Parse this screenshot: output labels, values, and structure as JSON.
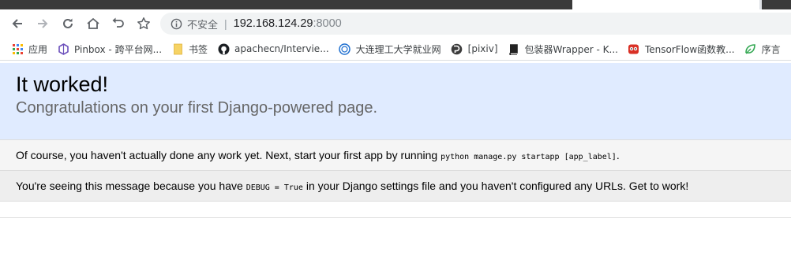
{
  "browser": {
    "address": {
      "security_label": "不安全",
      "separator": "|",
      "host": "192.168.124.29",
      "port": ":8000"
    },
    "bookmarks": [
      {
        "label": "应用",
        "icon": "apps-grid-icon"
      },
      {
        "label": "Pinbox - 跨平台网...",
        "icon": "pinbox-icon"
      },
      {
        "label": "书签",
        "icon": "folder-icon"
      },
      {
        "label": "apachecn/Intervie...",
        "icon": "github-icon"
      },
      {
        "label": "大连理工大学就业网",
        "icon": "university-icon"
      },
      {
        "label": "[pixiv]",
        "icon": "pixiv-icon"
      },
      {
        "label": "包装器Wrapper - K...",
        "icon": "book-icon"
      },
      {
        "label": "TensorFlow函数教...",
        "icon": "owl-icon"
      },
      {
        "label": "序言",
        "icon": "leaf-icon"
      }
    ]
  },
  "page": {
    "title": "It worked!",
    "subtitle": "Congratulations on your first Django-powered page.",
    "work": {
      "text": "Of course, you haven't actually done any work yet. Next, start your first app by running ",
      "code": "python manage.py startapp [app_label]",
      "end": "."
    },
    "instructions": {
      "text1": "You're seeing this message because you have ",
      "code": "DEBUG = True",
      "text2": " in your Django settings file and you haven't configured any URLs. Get to work!"
    }
  }
}
